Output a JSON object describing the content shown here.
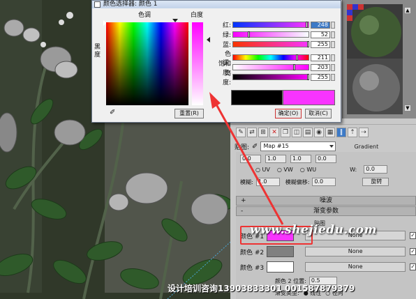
{
  "dialog": {
    "title": "颜色选择器: 颜色 1",
    "hue_label": "色调",
    "whiteness_label": "白度",
    "blackness_label": "黑度",
    "reset_label": "重置(R)",
    "ok_label": "确定(O)",
    "cancel_label": "取消(C)",
    "sliders": [
      {
        "label": "红:",
        "value": "248",
        "selected": true
      },
      {
        "label": "绿:",
        "value": "52"
      },
      {
        "label": "蓝:",
        "value": "255"
      },
      {
        "label": "色调:",
        "value": "211"
      },
      {
        "label": "饱和度:",
        "value": "203"
      },
      {
        "label": "亮度:",
        "value": "255"
      }
    ],
    "old_color": "#000000",
    "new_color": "#f834ff"
  },
  "panel": {
    "map_label": "贴图:",
    "map_name": "Map #15",
    "gradient_label": "Gradient",
    "uv_options": [
      "UV",
      "VW",
      "WU"
    ],
    "w_label": "W:",
    "w_value": "0.0",
    "blur_label": "模糊:",
    "blur_value": "1.0",
    "blur_offset_label": "模糊偏移:",
    "blur_offset_value": "0.0",
    "rotate_label": "旋转",
    "noise_rollout": "噪波",
    "gradient_rollout": "渐变参数",
    "maps_label": "贴图",
    "colors": [
      {
        "label": "颜色 #1",
        "swatch": "#f834ff",
        "map": "None"
      },
      {
        "label": "颜色 #2",
        "swatch": "#808080",
        "map": "None"
      },
      {
        "label": "颜色 #3",
        "swatch": "#ffffff",
        "map": "None"
      }
    ],
    "color2_pos_label": "颜色 2 位置:",
    "color2_pos_value": "0.5",
    "gradient_type_label": "渐变类型:",
    "gradient_type_options": [
      "线性",
      "径向"
    ]
  },
  "overlay": {
    "watermark": "www.shejiedu.com",
    "footer": "设计培训咨询13903833301 001587879379"
  },
  "accent": "#3d7ac7",
  "highlight": "#e33333"
}
